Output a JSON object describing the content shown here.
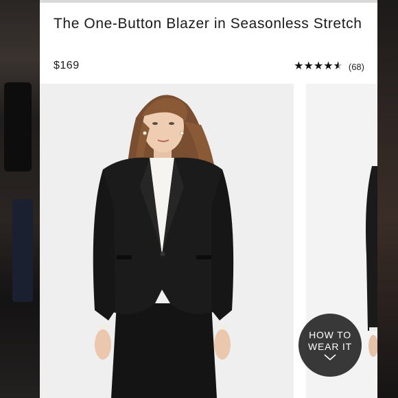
{
  "product": {
    "title": "The One-Button Blazer in Seasonless Stretch",
    "price": "$169",
    "rating_value": 4.5,
    "rating_max": 5,
    "review_count": "(68)"
  },
  "gallery": {
    "main_image": "model-in-black-blazer-and-skirt",
    "next_image": "side-view-black-blazer"
  },
  "wear_button": {
    "line1": "HOW TO",
    "line2": "WEAR IT",
    "icon": "chevron-down-icon"
  }
}
